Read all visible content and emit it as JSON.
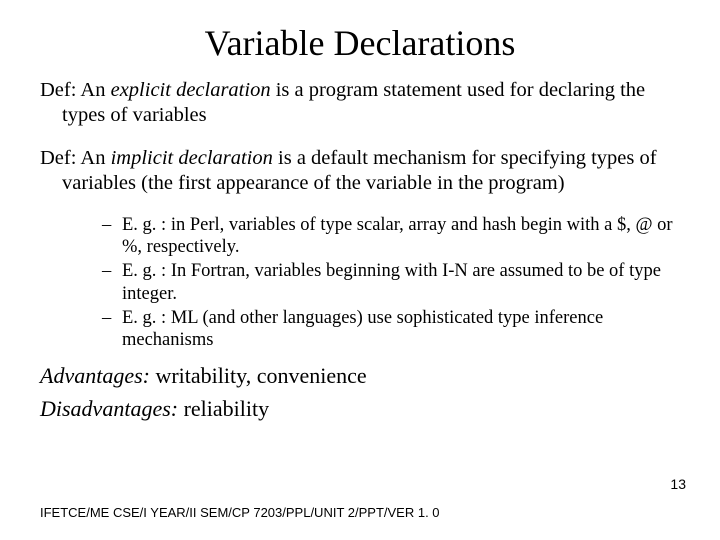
{
  "title": "Variable Declarations",
  "def1_prefix": "Def: An ",
  "def1_term": "explicit declaration",
  "def1_rest": " is a program statement used for declaring the types of variables",
  "def2_prefix": "Def: An ",
  "def2_term": "implicit declaration",
  "def2_rest": " is a default mechanism for specifying types of variables (the first appearance of the variable in the program)",
  "examples": [
    "E. g. : in Perl, variables of type scalar, array and hash begin with a $, @ or %, respectively.",
    "E. g. : In Fortran, variables beginning with I-N are assumed to be of type integer.",
    "E. g. : ML (and other languages) use sophisticated type inference mechanisms"
  ],
  "adv_label": "Advantages:",
  "adv_text": " writability, convenience",
  "dis_label": "Disadvantages:",
  "dis_text": " reliability",
  "page_number": "13",
  "footer": "IFETCE/ME CSE/I YEAR/II SEM/CP 7203/PPL/UNIT 2/PPT/VER 1. 0"
}
